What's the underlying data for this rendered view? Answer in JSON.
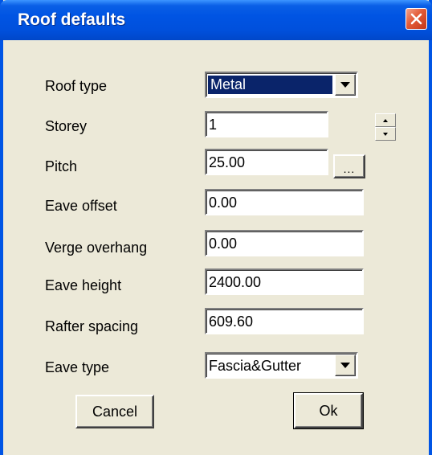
{
  "window": {
    "title": "Roof defaults"
  },
  "fields": {
    "roof_type": {
      "label": "Roof type",
      "value": "Metal"
    },
    "storey": {
      "label": "Storey",
      "value": "1"
    },
    "pitch": {
      "label": "Pitch",
      "value": "25.00",
      "browse_label": "..."
    },
    "eave_offset": {
      "label": "Eave offset",
      "value": "0.00"
    },
    "verge_overhang": {
      "label": "Verge overhang",
      "value": "0.00"
    },
    "eave_height": {
      "label": "Eave height",
      "value": "2400.00"
    },
    "rafter_spacing": {
      "label": "Rafter spacing",
      "value": "609.60"
    },
    "eave_type": {
      "label": "Eave type",
      "value": "Fascia&Gutter"
    }
  },
  "buttons": {
    "cancel": "Cancel",
    "ok": "Ok"
  },
  "icons": {
    "close": "close-icon",
    "dropdown": "chevron-down-icon",
    "spinner": "spinner-icon"
  },
  "colors": {
    "titlebar": "#0054e3",
    "close": "#e35a36",
    "selection": "#0a246a",
    "face": "#ece9d8"
  }
}
